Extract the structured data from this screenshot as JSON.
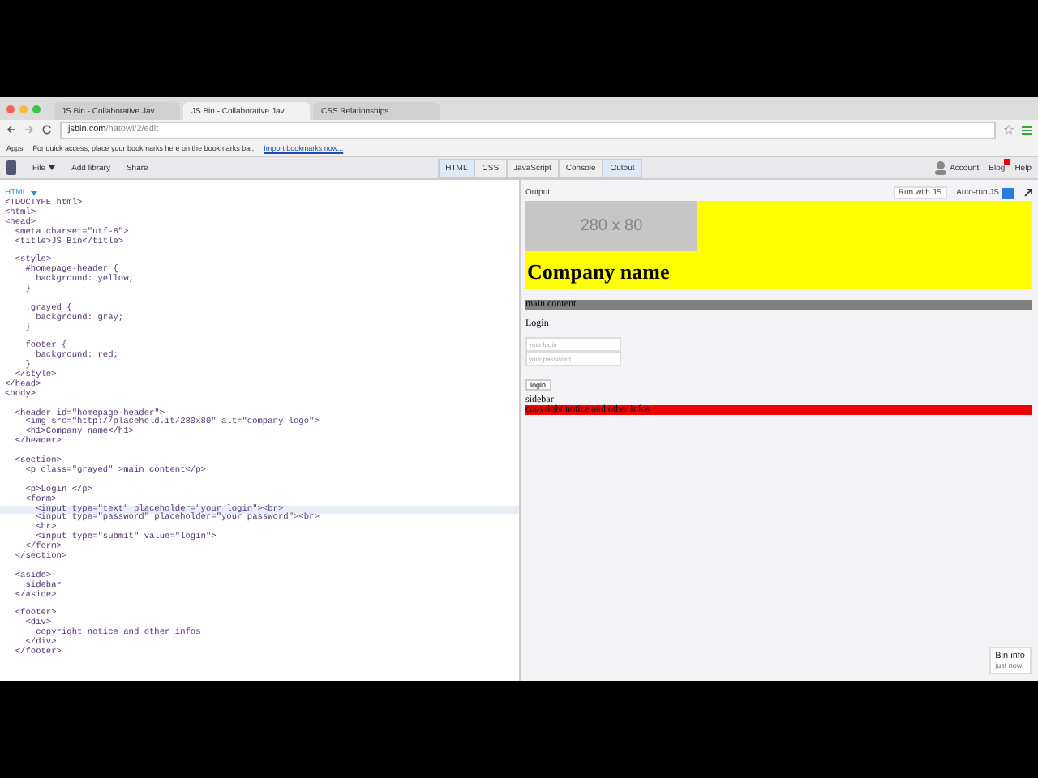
{
  "browser": {
    "tabs": [
      {
        "title": "JS Bin - Collaborative Jav",
        "selected": false
      },
      {
        "title": "JS Bin - Collaborative Jav",
        "selected": true
      },
      {
        "title": "CSS Relationships",
        "selected": false
      }
    ],
    "address": {
      "host": "jsbin.com",
      "path": "/hatowi/2/edit"
    },
    "bookmarks_bar": {
      "apps": "Apps",
      "hint": "For quick access, place your bookmarks here on the bookmarks bar.",
      "import_link": "Import bookmarks now..."
    }
  },
  "toolbar": {
    "menu": [
      {
        "label": "File",
        "dropdown": true
      },
      {
        "label": "Add library",
        "dropdown": false
      },
      {
        "label": "Share",
        "dropdown": false
      }
    ],
    "panels": [
      {
        "label": "HTML",
        "selected": true
      },
      {
        "label": "CSS",
        "selected": false
      },
      {
        "label": "JavaScript",
        "selected": false
      },
      {
        "label": "Console",
        "selected": false
      },
      {
        "label": "Output",
        "selected": true
      }
    ],
    "right": [
      {
        "label": "Account",
        "kind": "avatar"
      },
      {
        "label": "Blog",
        "kind": "badge"
      },
      {
        "label": "Help",
        "kind": "plain"
      }
    ]
  },
  "editor": {
    "language": "HTML",
    "lines": [
      {
        "kind": "code",
        "text": "<!DOCTYPE html>",
        "highlighted": false
      },
      {
        "kind": "code",
        "text": "<html>",
        "highlighted": false
      },
      {
        "kind": "code",
        "text": "<head>",
        "highlighted": false
      },
      {
        "kind": "code",
        "text": "  <meta charset=\"utf-8\">",
        "highlighted": false
      },
      {
        "kind": "code",
        "text": "  <title>JS Bin</title>",
        "highlighted": false
      },
      {
        "kind": "blank",
        "highlighted": false
      },
      {
        "kind": "code",
        "text": "  <style>",
        "highlighted": false
      },
      {
        "kind": "code",
        "text": "    #homepage-header {",
        "highlighted": false
      },
      {
        "kind": "code",
        "text": "      background: yellow;",
        "highlighted": false
      },
      {
        "kind": "code",
        "text": "    }",
        "highlighted": false
      },
      {
        "kind": "blank",
        "highlighted": false
      },
      {
        "kind": "code",
        "text": "    .grayed {",
        "highlighted": false
      },
      {
        "kind": "code",
        "text": "      background: gray;",
        "highlighted": false
      },
      {
        "kind": "code",
        "text": "    }",
        "highlighted": false
      },
      {
        "kind": "blank",
        "highlighted": false
      },
      {
        "kind": "code",
        "text": "    footer {",
        "highlighted": false
      },
      {
        "kind": "code",
        "text": "      background: red;",
        "highlighted": false
      },
      {
        "kind": "code",
        "text": "    }",
        "highlighted": false
      },
      {
        "kind": "code",
        "text": "  </style>",
        "highlighted": false
      },
      {
        "kind": "code",
        "text": "</head>",
        "highlighted": false
      },
      {
        "kind": "code",
        "text": "<body>",
        "highlighted": false
      },
      {
        "kind": "blank",
        "highlighted": false
      },
      {
        "kind": "code",
        "text": "  <header id=\"homepage-header\">",
        "highlighted": false
      },
      {
        "kind": "code",
        "text": "    <img src=\"http://placehold.it/280x80\" alt=\"company logo\">",
        "highlighted": false
      },
      {
        "kind": "code",
        "text": "    <h1>Company name</h1>",
        "highlighted": false
      },
      {
        "kind": "code",
        "text": "  </header>",
        "highlighted": false
      },
      {
        "kind": "blank",
        "highlighted": false
      },
      {
        "kind": "code",
        "text": "  <section>",
        "highlighted": false
      },
      {
        "kind": "code",
        "text": "    <p class=\"grayed\" >main content</p>",
        "highlighted": false
      },
      {
        "kind": "blank",
        "highlighted": false
      },
      {
        "kind": "code",
        "text": "    <p>Login </p>",
        "highlighted": false
      },
      {
        "kind": "code",
        "text": "    <form>",
        "highlighted": false
      },
      {
        "kind": "code",
        "text": "      <input type=\"text\" placeholder=\"your login\"><br>",
        "highlighted": true
      },
      {
        "kind": "code",
        "text": "      <input type=\"password\" placeholder=\"your password\"><br>",
        "highlighted": false
      },
      {
        "kind": "code",
        "text": "      <br>",
        "highlighted": false
      },
      {
        "kind": "code",
        "text": "      <input type=\"submit\" value=\"login\">",
        "highlighted": false
      },
      {
        "kind": "code",
        "text": "    </form>",
        "highlighted": false
      },
      {
        "kind": "code",
        "text": "  </section>",
        "highlighted": false
      },
      {
        "kind": "blank",
        "highlighted": false
      },
      {
        "kind": "code",
        "text": "  <aside>",
        "highlighted": false
      },
      {
        "kind": "code",
        "text": "    sidebar",
        "highlighted": false
      },
      {
        "kind": "code",
        "text": "  </aside>",
        "highlighted": false
      },
      {
        "kind": "blank",
        "highlighted": false
      },
      {
        "kind": "code",
        "text": "  <footer>",
        "highlighted": false
      },
      {
        "kind": "code",
        "text": "    <div>",
        "highlighted": false
      },
      {
        "kind": "code",
        "text": "      copyright notice and other infos",
        "highlighted": false
      },
      {
        "kind": "code",
        "text": "    </div>",
        "highlighted": false
      },
      {
        "kind": "code",
        "text": "  </footer>",
        "highlighted": false
      }
    ]
  },
  "output": {
    "title": "Output",
    "run_button": "Run with JS",
    "autorun": {
      "label": "Auto-run JS",
      "checked": true
    },
    "page": {
      "logo_placeholder": "280 x 80",
      "heading": "Company name",
      "main_content": "main content",
      "login_label": "Login",
      "login_field": {
        "placeholder": "your login"
      },
      "password_field": {
        "placeholder": "your password"
      },
      "submit": "login",
      "sidebar": "sidebar",
      "footer": "copyright notice and other infos"
    },
    "bin_info": {
      "title": "Bin info",
      "time": "just now"
    }
  }
}
